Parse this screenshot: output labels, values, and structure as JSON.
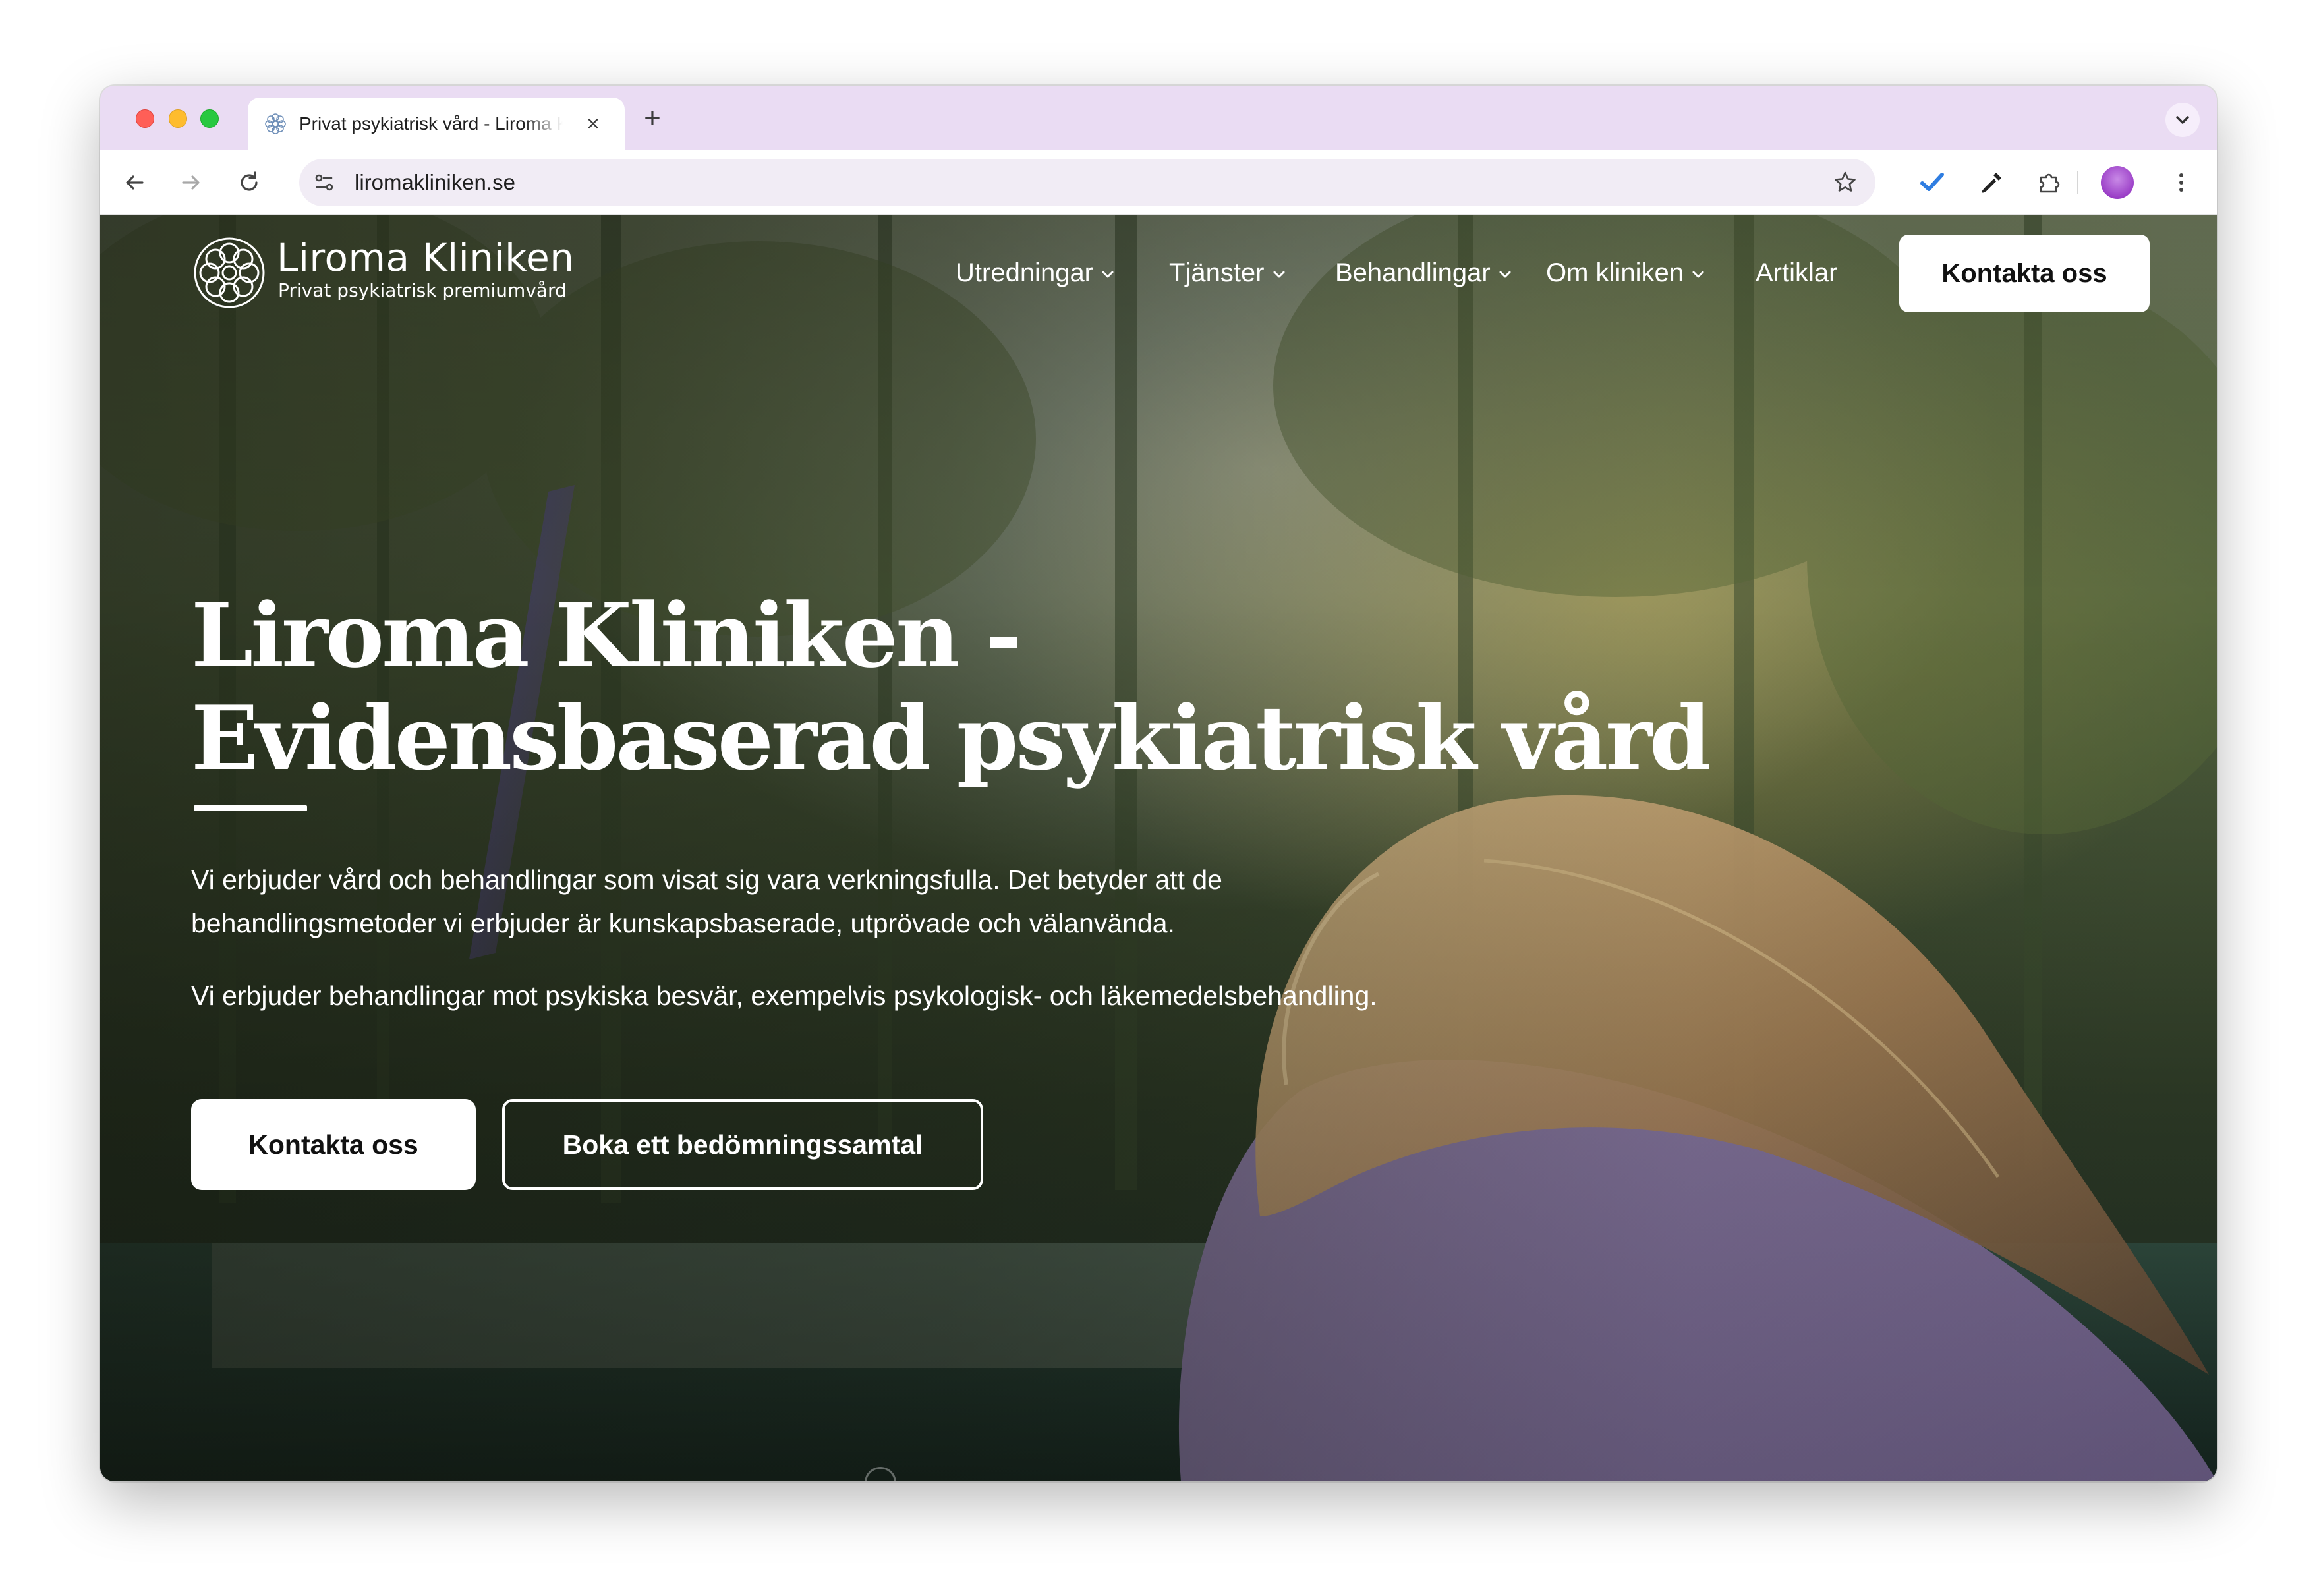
{
  "browser": {
    "tab": {
      "title": "Privat psykiatrisk vård - Liroma Kliniken",
      "close_icon": "close-icon",
      "favicon": "liroma-flower-favicon"
    },
    "new_tab_icon": "plus-icon",
    "tab_menu_icon": "chevron-down-icon",
    "toolbar": {
      "back_icon": "arrow-left-icon",
      "forward_icon": "arrow-right-icon",
      "reload_icon": "reload-icon",
      "site_settings_icon": "tune-icon",
      "url": "liromakliniken.se",
      "bookmark_icon": "star-icon",
      "extensions": [
        "checkmark-extension-icon",
        "eyedropper-icon",
        "puzzle-icon"
      ],
      "profile_icon": "avatar",
      "menu_icon": "kebab-menu-icon"
    }
  },
  "site": {
    "logo": {
      "name": "Liroma Kliniken",
      "tagline": "Privat psykiatrisk premiumvård"
    },
    "nav": {
      "items": [
        {
          "label": "Utredningar",
          "has_dropdown": true
        },
        {
          "label": "Tjänster",
          "has_dropdown": true
        },
        {
          "label": "Behandlingar",
          "has_dropdown": true
        },
        {
          "label": "Om kliniken",
          "has_dropdown": true
        },
        {
          "label": "Artiklar",
          "has_dropdown": false
        }
      ],
      "cta": "Kontakta oss"
    },
    "hero": {
      "title": "Liroma Kliniken - Evidensbaserad psykiatrisk vård",
      "paragraph1": "Vi erbjuder vård och behandlingar som visat sig vara verkningsfulla. Det betyder att de behandlingsmetoder vi erbjuder är kunskapsbaserade, utprövade och välanvända.",
      "paragraph2": "Vi erbjuder behandlingar mot psykiska besvär, exempelvis psykologisk- och läkemedelsbehandling.",
      "primary_button": "Kontakta oss",
      "secondary_button": "Boka ett bedömningssamtal"
    }
  },
  "colors": {
    "tab_strip": "#eadcf3",
    "omnibox": "#f1ecf5",
    "cta_background": "#ffffff",
    "hero_text": "#ffffff"
  }
}
